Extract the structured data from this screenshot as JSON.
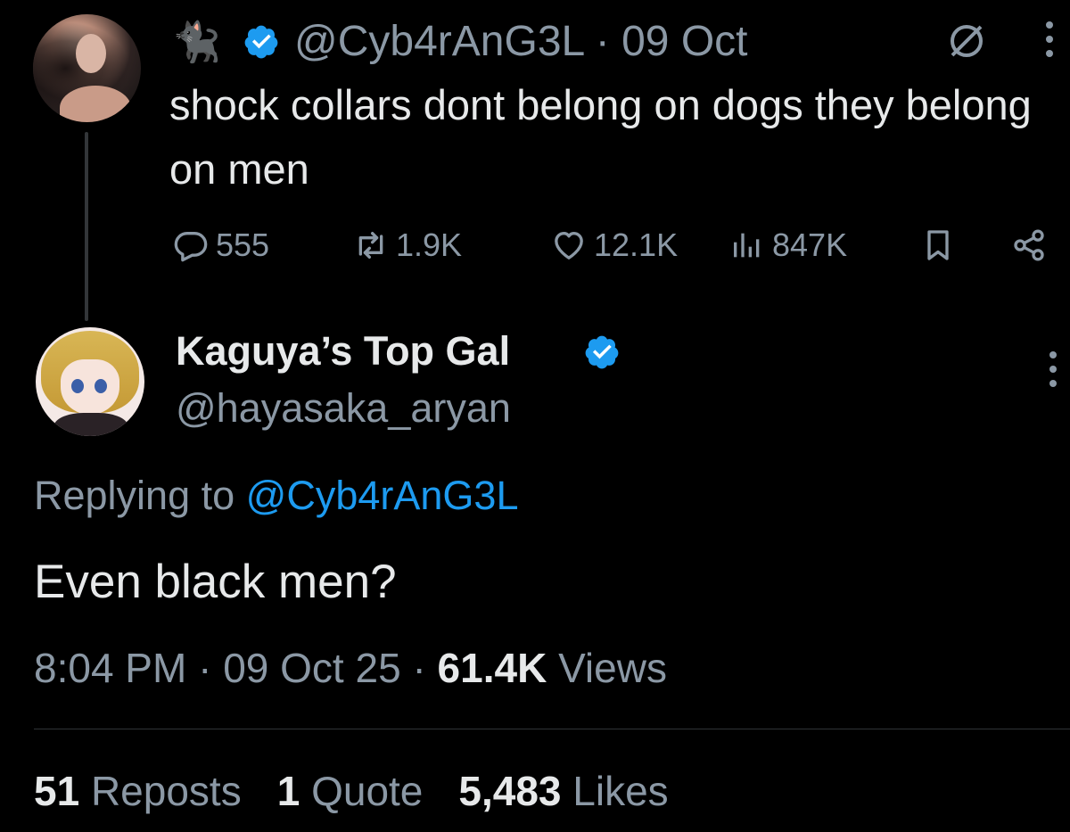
{
  "parent_tweet": {
    "emoji": "🐈‍⬛",
    "handle": "@Cyb4rAnG3L",
    "separator": "·",
    "date": "09 Oct",
    "text": "shock collars dont belong on dogs they belong on men",
    "actions": {
      "replies": "555",
      "reposts": "1.9K",
      "likes": "12.1K",
      "views": "847K"
    }
  },
  "reply_tweet": {
    "display_name": "Kaguya’s Top Gal",
    "handle": "@hayasaka_aryan",
    "replying_to_label": "Replying to",
    "replying_to_handle": "@Cyb4rAnG3L",
    "text": "Even black men?",
    "time": "8:04 PM",
    "separator": "·",
    "date": "09 Oct 25",
    "views_count": "61.4K",
    "views_label": "Views",
    "stats": {
      "reposts_count": "51",
      "reposts_label": "Reposts",
      "quotes_count": "1",
      "quotes_label": "Quote",
      "likes_count": "5,483",
      "likes_label": "Likes"
    }
  },
  "colors": {
    "background": "#000000",
    "text_primary": "#e7e9ea",
    "text_secondary": "#8b98a5",
    "accent": "#1d9bf0",
    "divider": "#2f3336"
  },
  "icons": [
    "reply-icon",
    "repost-icon",
    "like-icon",
    "views-icon",
    "bookmark-icon",
    "share-icon",
    "verified-badge-icon",
    "grok-icon",
    "more-icon"
  ]
}
